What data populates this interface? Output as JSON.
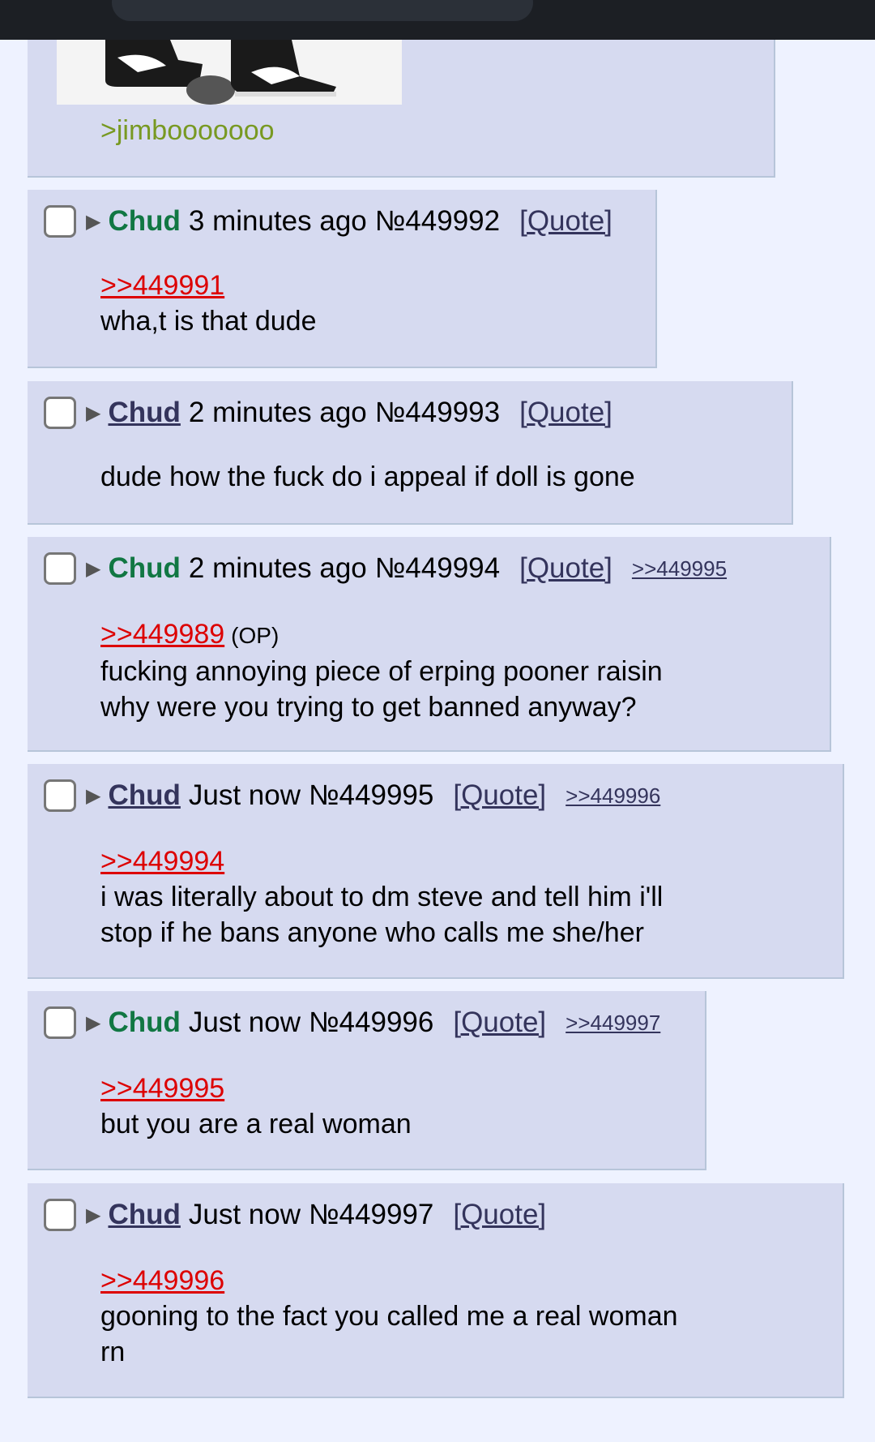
{
  "first_post": {
    "greentext": ">jimbooooooo"
  },
  "common": {
    "quote_label": "[Quote]",
    "op_label": "(OP)"
  },
  "posts": [
    {
      "name": "Chud",
      "time": "3 minutes ago",
      "no": "№449992",
      "reply_to": ">>449991",
      "backlink": "",
      "lines": [
        "wha,t is that dude"
      ]
    },
    {
      "name": "Chud",
      "time": "2 minutes ago",
      "no": "№449993",
      "reply_to": "",
      "backlink": "",
      "lines": [
        "dude how the fuck do i appeal if doll is gone"
      ]
    },
    {
      "name": "Chud",
      "time": "2 minutes ago",
      "no": "№449994",
      "reply_to": ">>449989",
      "backlink": ">>449995",
      "lines": [
        "fucking annoying piece of erping pooner raisin",
        "why were you trying to get banned anyway?"
      ]
    },
    {
      "name": "Chud",
      "time": "Just now",
      "no": "№449995",
      "reply_to": ">>449994",
      "backlink": ">>449996",
      "lines": [
        "i was literally about to dm steve and tell him i'll",
        "stop if he bans anyone who calls me she/her"
      ]
    },
    {
      "name": "Chud",
      "time": "Just now",
      "no": "№449996",
      "reply_to": ">>449995",
      "backlink": ">>449997",
      "lines": [
        "but you are a real woman"
      ]
    },
    {
      "name": "Chud",
      "time": "Just now",
      "no": "№449997",
      "reply_to": ">>449996",
      "backlink": "",
      "lines": [
        "gooning to the fact you called me a real woman",
        "rn"
      ]
    }
  ]
}
